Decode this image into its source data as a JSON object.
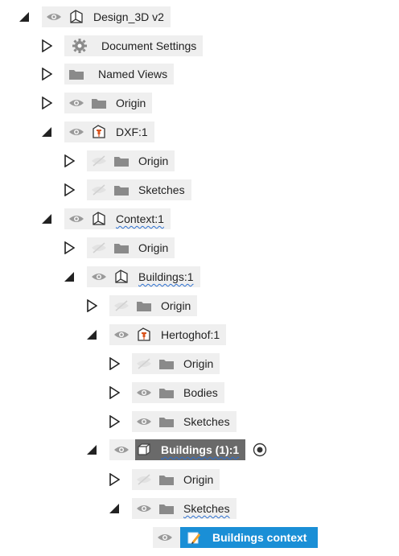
{
  "tree": {
    "rows": [
      {
        "label": "Design_3D v2",
        "icon": "component-icon"
      },
      {
        "label": "Document Settings",
        "icon": "gear-icon"
      },
      {
        "label": "Named Views",
        "icon": "folder-icon"
      },
      {
        "label": "Origin",
        "icon": "folder-icon"
      },
      {
        "label": "DXF:1",
        "icon": "pinned-component-icon"
      },
      {
        "label": "Origin",
        "icon": "folder-icon"
      },
      {
        "label": "Sketches",
        "icon": "folder-icon"
      },
      {
        "label": "Context:1",
        "icon": "component-icon"
      },
      {
        "label": "Origin",
        "icon": "folder-icon"
      },
      {
        "label": "Buildings:1",
        "icon": "component-icon"
      },
      {
        "label": "Origin",
        "icon": "folder-icon"
      },
      {
        "label": "Hertoghof:1",
        "icon": "pinned-component-icon"
      },
      {
        "label": "Origin",
        "icon": "folder-icon"
      },
      {
        "label": "Bodies",
        "icon": "folder-icon"
      },
      {
        "label": "Sketches",
        "icon": "folder-icon"
      },
      {
        "label": "Buildings (1):1",
        "icon": "body-component-icon"
      },
      {
        "label": "Origin",
        "icon": "folder-icon"
      },
      {
        "label": "Sketches",
        "icon": "folder-icon"
      },
      {
        "label": "Buildings context",
        "icon": "sketch-icon"
      }
    ]
  },
  "colors": {
    "selection": "#1a8fd6",
    "active_component": "#6a6a6a",
    "row_background": "#efefef",
    "wavy_underline": "#2c6fcf",
    "pin": "#d9541e"
  }
}
